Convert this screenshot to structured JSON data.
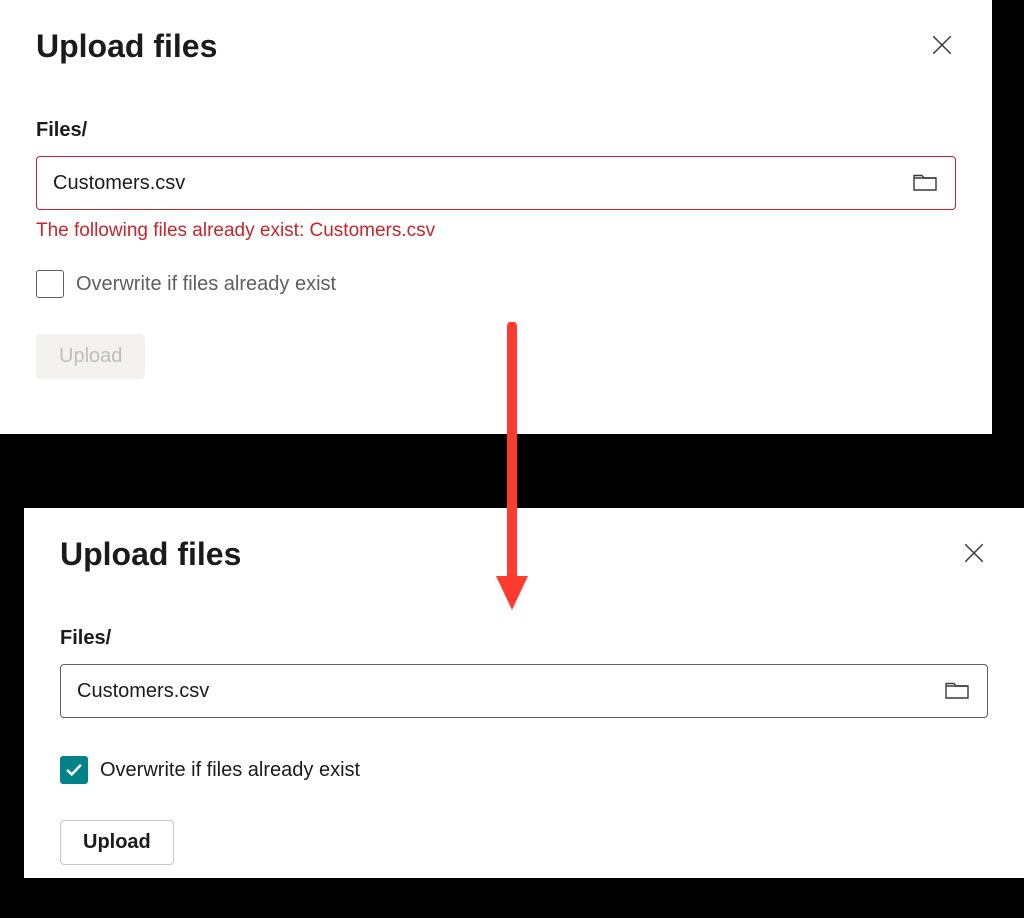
{
  "panel1": {
    "title": "Upload files",
    "field_label": "Files/",
    "file_value": "Customers.csv",
    "error_message": "The following files already exist: Customers.csv",
    "overwrite_label": "Overwrite if files already exist",
    "upload_label": "Upload",
    "checkbox_checked": false,
    "upload_enabled": false
  },
  "panel2": {
    "title": "Upload files",
    "field_label": "Files/",
    "file_value": "Customers.csv",
    "overwrite_label": "Overwrite if files already exist",
    "upload_label": "Upload",
    "checkbox_checked": true,
    "upload_enabled": true
  },
  "colors": {
    "error": "#c5262c",
    "accent": "#038387"
  }
}
